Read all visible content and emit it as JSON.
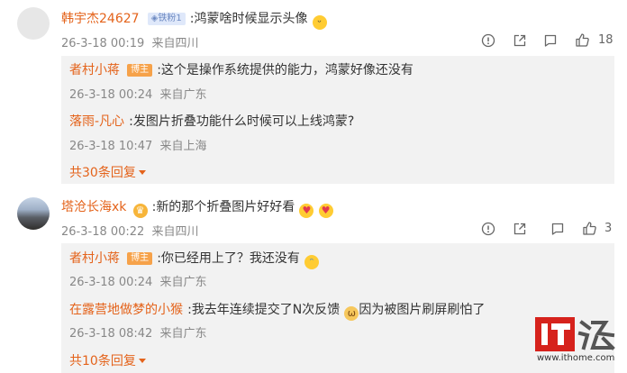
{
  "comments": [
    {
      "author": "韩宇杰24627",
      "fan_badge": "◈铁粉1",
      "separator": ":",
      "text": "鸿蒙啥时候显示头像",
      "date": "26-3-18 00:19",
      "location": "来自四川",
      "likes": "18",
      "replies": [
        {
          "author": "者村小蒋",
          "badge": "博主",
          "separator": ":",
          "text": "这个是操作系统提供的能力，鸿蒙好像还没有",
          "date": "26-3-18 00:24",
          "location": "来自广东"
        },
        {
          "author": "落雨-凡心",
          "separator": ":",
          "text": "发图片折叠功能什么时候可以上线鸿蒙?",
          "date": "26-3-18 10:47",
          "location": "来自上海"
        }
      ],
      "more_replies": "共30条回复"
    },
    {
      "author": "塔沧长海xk",
      "separator": ":",
      "text": "新的那个折叠图片好好看",
      "date": "26-3-18 00:22",
      "location": "来自四川",
      "likes": "3",
      "replies": [
        {
          "author": "者村小蒋",
          "badge": "博主",
          "separator": ":",
          "text": "你已经用上了？我还没有",
          "date": "26-3-18 00:24",
          "location": "来自广东"
        },
        {
          "author": "在露营地做梦的小猴",
          "separator": ":",
          "text": "我去年连续提交了N次反馈",
          "text_tail": "因为被图片刷屏刷怕了",
          "date": "26-3-18 08:42",
          "location": "来自广东"
        }
      ],
      "more_replies": "共10条回复"
    }
  ],
  "watermark": {
    "logo_text": "IT之家",
    "url": "www.ithome.com"
  },
  "colors": {
    "accent": "#e4631b",
    "logo_red": "#d6221c",
    "host_badge": "#f6a24a"
  }
}
